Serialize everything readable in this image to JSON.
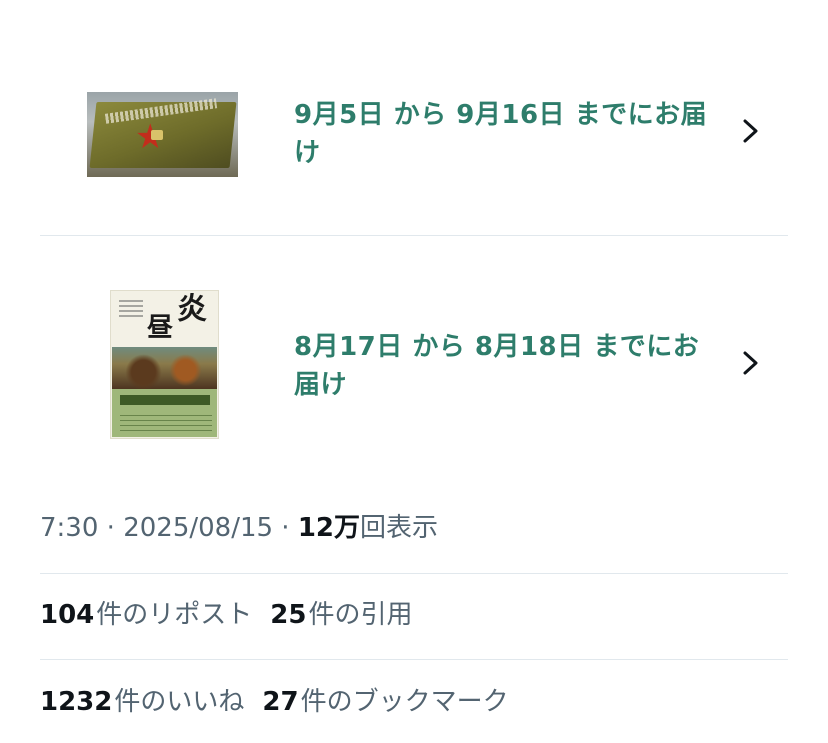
{
  "orders": [
    {
      "delivery_text": "9月5日 から 9月16日 までにお届け",
      "thumbnail_icon": "book-cover-red-star"
    },
    {
      "delivery_text": "8月17日 から 8月18日 までにお届け",
      "thumbnail_icon": "book-cover-honoo"
    }
  ],
  "post_meta": {
    "time": "7:30",
    "separator": " · ",
    "date": "2025/08/15",
    "views_count": "12万",
    "views_label": "回表示"
  },
  "stats": {
    "reposts_count": "104",
    "reposts_label": "件のリポスト",
    "quotes_count": "25",
    "quotes_label": "件の引用",
    "likes_count": "1232",
    "likes_label": "件のいいね",
    "bookmarks_count": "27",
    "bookmarks_label": "件のブックマーク"
  },
  "colors": {
    "accent_green": "#2e7d6b",
    "secondary_text": "#536471",
    "primary_text": "#0f1419",
    "divider": "#e1e8ed"
  }
}
